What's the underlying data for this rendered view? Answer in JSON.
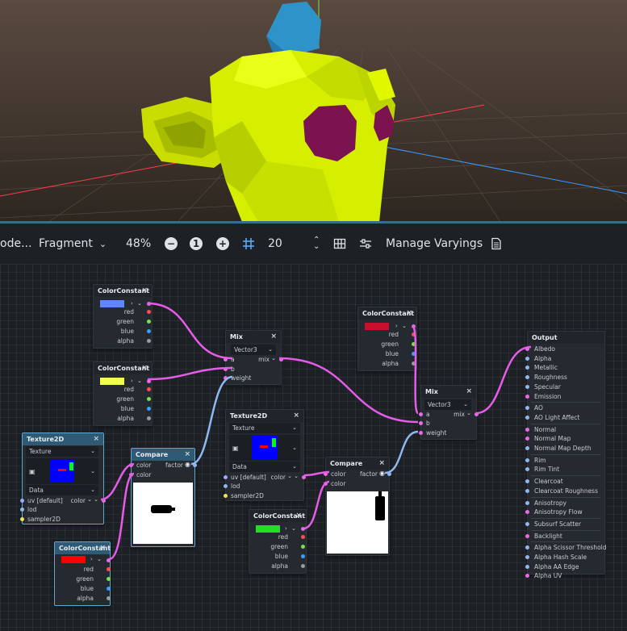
{
  "toolbar": {
    "mode_prefix": "ode...",
    "shader_stage": "Fragment",
    "zoom": "48%",
    "zoom_reset_label": "1",
    "grid_step": "20",
    "manage_varyings": "Manage Varyings"
  },
  "nodes": {
    "cc1": {
      "title": "ColorConstant",
      "color": "#5f86ff",
      "ports": [
        "red",
        "green",
        "blue",
        "alpha"
      ]
    },
    "cc2": {
      "title": "ColorConstant",
      "color": "#f2ff4c",
      "ports": [
        "red",
        "green",
        "blue",
        "alpha"
      ]
    },
    "cc3": {
      "title": "ColorConstant",
      "color": "#c8102e",
      "ports": [
        "red",
        "green",
        "blue",
        "alpha"
      ]
    },
    "cc4": {
      "title": "ColorConstant",
      "color": "#20e020",
      "ports": [
        "red",
        "green",
        "blue",
        "alpha"
      ]
    },
    "cc5": {
      "title": "ColorConstant",
      "color": "#ff0000",
      "ports": [
        "red",
        "green",
        "blue",
        "alpha"
      ]
    },
    "mix1": {
      "title": "Mix",
      "type": "Vector3",
      "in_a": "a",
      "in_b": "b",
      "in_weight": "weight",
      "out": "mix"
    },
    "mix2": {
      "title": "Mix",
      "type": "Vector3",
      "in_a": "a",
      "in_b": "b",
      "in_weight": "weight",
      "out": "mix"
    },
    "tex1": {
      "title": "Texture2D",
      "source": "Texture",
      "output_mode": "Data",
      "uv": "uv [default]",
      "out": "color",
      "lod": "lod",
      "sampler": "sampler2D"
    },
    "tex2": {
      "title": "Texture2D",
      "source": "Texture",
      "output_mode": "Data",
      "uv": "uv [default]",
      "out": "color",
      "lod": "lod",
      "sampler": "sampler2D"
    },
    "cmp1": {
      "title": "Compare",
      "in1": "color",
      "in2": "color",
      "out": "factor"
    },
    "cmp2": {
      "title": "Compare",
      "in1": "color",
      "in2": "color",
      "out": "factor"
    },
    "output": {
      "title": "Output",
      "groups": [
        [
          "Albedo",
          "Alpha",
          "Metallic",
          "Roughness",
          "Specular",
          "Emission"
        ],
        [
          "AO",
          "AO Light Affect"
        ],
        [
          "Normal",
          "Normal Map",
          "Normal Map Depth"
        ],
        [
          "Rim",
          "Rim Tint"
        ],
        [
          "Clearcoat",
          "Clearcoat Roughness"
        ],
        [
          "Anisotropy",
          "Anisotropy Flow"
        ],
        [
          "Subsurf Scatter"
        ],
        [
          "Backlight"
        ],
        [
          "Alpha Scissor Threshold",
          "Alpha Hash Scale",
          "Alpha AA Edge",
          "Alpha UV"
        ]
      ]
    }
  },
  "colors": {
    "wire_vec": "#e45ce8",
    "wire_float": "#8fb8f0",
    "port_vec": "#e86ae8",
    "port_float": "#8fb8f0",
    "red_port": "#ff4d4d",
    "green_port": "#7be04a",
    "blue_port": "#3a9dff",
    "alpha_port": "#9a9a9a",
    "mesh_yellow": "#d6ef00",
    "mesh_purple": "#7a1350",
    "mesh_blue": "#2e93c8"
  }
}
